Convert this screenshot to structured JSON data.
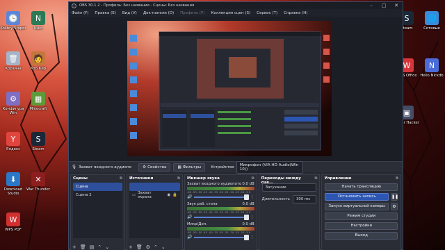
{
  "desktop_left": [
    {
      "label": "Kolibry Stoper",
      "glyph": "🕒",
      "color": "#5d86d6"
    },
    {
      "label": "Nuxt",
      "glyph": "N",
      "color": "#2b7a55"
    },
    {
      "label": "Корзина",
      "glyph": "🗑",
      "color": "#a5b4c8"
    },
    {
      "label": "Кто Кир",
      "glyph": "🧑",
      "color": "#c5763a"
    },
    {
      "label": "Конфигура Win",
      "glyph": "⚙",
      "color": "#7e6fc2"
    },
    {
      "label": "Minecraft",
      "glyph": "▦",
      "color": "#5f9a3a"
    },
    {
      "label": "Яндекс",
      "glyph": "Y",
      "color": "#e0463d"
    },
    {
      "label": "Steam",
      "glyph": "S",
      "color": "#1b2838"
    },
    {
      "label": "Download Studio",
      "glyph": "⬇",
      "color": "#2a78c7"
    },
    {
      "label": "War Thunder",
      "glyph": "✕",
      "color": "#8d1e1e"
    },
    {
      "label": "WPS PDF",
      "glyph": "W",
      "color": "#d22f2f"
    }
  ],
  "desktop_right": [
    {
      "label": "Steam",
      "glyph": "S",
      "color": "#1b2838"
    },
    {
      "label": "Сетевые",
      "glyph": "🌐",
      "color": "#3a8ad8"
    },
    {
      "label": "WPS Office",
      "glyph": "W",
      "color": "#d6363a"
    },
    {
      "label": "Hello Nickdb",
      "glyph": "N",
      "color": "#4b6cd8"
    },
    {
      "label": "Cyber Hacker",
      "glyph": "▣",
      "color": "#444c66"
    }
  ],
  "window": {
    "title": "OBS 30.1.2 - Профиль: Без названия - Сцены: Без названия",
    "menu": [
      "Файл (F)",
      "Правка (E)",
      "Вид (V)",
      "Док-панели (D)",
      "Профиль (P)",
      "Коллекция сцен (S)",
      "Сервис (T)",
      "Справка (H)"
    ],
    "menu_dim_index": 4
  },
  "context_bar": {
    "source_name": "Захват входного аудиопо",
    "properties": "Свойства",
    "filters": "Фильтры",
    "device_label": "Устройство",
    "device_value": "Микрофон (VIA HD Audio(Win 10))"
  },
  "scenes": {
    "title": "Сцены",
    "items": [
      "Сцена",
      "Сцена 2"
    ],
    "active": 0
  },
  "sources": {
    "title": "Источники",
    "items": [
      "",
      "Захват экрана"
    ],
    "active": 0
  },
  "mixer": {
    "title": "Микшер звука",
    "channels": [
      {
        "name": "Захват входного аудиопото",
        "db": "0.0 dB",
        "scale": "-60 -55 -50 -45 -40 -35 -30 -25 -20 -15 -10 -5 0"
      },
      {
        "name": "Звук раб. стола",
        "db": "0.0 dB",
        "scale": "-60 -55 -50 -45 -40 -35 -30 -25 -20 -15 -10 -5 0"
      },
      {
        "name": "Микр/Доп.",
        "db": "0.0 dB",
        "scale": "-60 -55 -50 -45 -40 -35 -30 -25 -20 -15 -10 -5 0"
      }
    ]
  },
  "transitions": {
    "title": "Переходы между сце...",
    "type": "Затухание",
    "duration_label": "Длительность",
    "duration_value": "300 ms"
  },
  "controls": {
    "title": "Управление",
    "buttons": [
      "Начать трансляцию",
      "Остановить запись",
      "Запуск виртуальной камеры",
      "Режим студии",
      "Настройки",
      "Выход"
    ],
    "active_index": 1
  },
  "icons": {
    "gear": "⚙",
    "plus": "+",
    "minus": "−",
    "trash": "🗑",
    "up": "⌃",
    "down": "⌄",
    "pause": "❚❚",
    "eye": "◉",
    "lock": "🔒",
    "mic": "🎙",
    "speaker": "🔊"
  }
}
